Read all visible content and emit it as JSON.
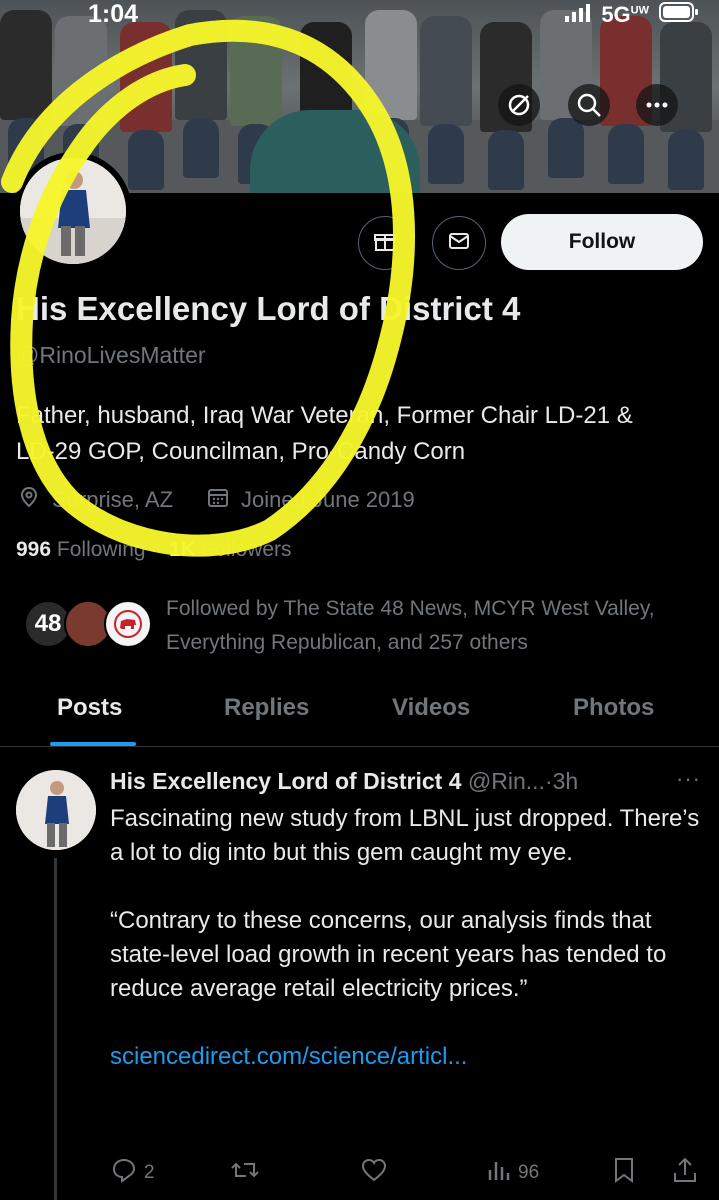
{
  "status_bar": {
    "time": "1:04",
    "network": "5G",
    "network_sub": "UW"
  },
  "profile": {
    "name": "His Excellency Lord of District 4",
    "handle": "@RinoLivesMatter",
    "bio_line1": "Father, husband, Iraq War Veteran, Former Chair LD-21 &",
    "bio_line2": "LD-29 GOP, Councilman, Pro-Candy Corn",
    "location": "Surprise, AZ",
    "joined": "Joined June 2019",
    "following_count": "996",
    "following_label": "Following",
    "followers_count": "1K",
    "followers_label": "Followers",
    "follow_button": "Follow"
  },
  "followed_by": {
    "text": "Followed by The State 48 News, MCYR West Valley, Everything Republican, and 257 others",
    "badge_48": "48"
  },
  "tabs": [
    {
      "label": "Posts",
      "active": true
    },
    {
      "label": "Replies",
      "active": false
    },
    {
      "label": "Videos",
      "active": false
    },
    {
      "label": "Photos",
      "active": false
    }
  ],
  "post": {
    "author": "His Excellency Lord of District 4",
    "handle": "@Rin...",
    "sep": "·",
    "time": "3h",
    "more": "···",
    "para1": "Fascinating new study from LBNL just dropped. There’s a lot to dig into but this gem caught my eye.",
    "para2": "“Contrary to these concerns, our analysis finds that state-level load growth in recent years has tended to reduce average retail electricity prices.”",
    "link": "sciencedirect.com/science/articl...",
    "replies": "2",
    "views": "96"
  },
  "colors": {
    "background": "#000000",
    "text": "#e7e9ea",
    "muted": "#71767b",
    "accent": "#1d9bf0",
    "highlighter": "#f5f52b"
  },
  "icons": [
    "circle-slash-icon",
    "search-icon",
    "more-icon",
    "gift-icon",
    "mail-icon",
    "location-icon",
    "calendar-icon",
    "reply-icon",
    "retweet-icon",
    "like-icon",
    "views-icon",
    "bookmark-icon",
    "share-icon"
  ]
}
